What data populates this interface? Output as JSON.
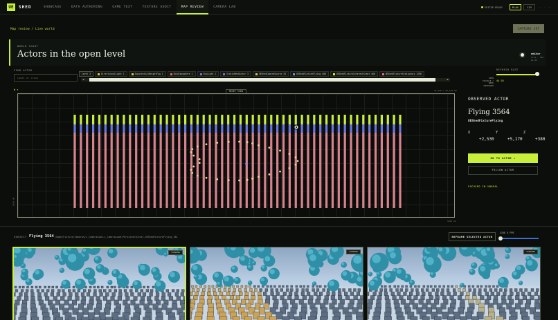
{
  "app": {
    "logo": "UE",
    "brand": "SHED"
  },
  "nav": [
    "SHOWCASE",
    "DATA AUTHORING",
    "GAME TEXT",
    "TEXTURE AUDIT",
    "MAP REVIEW",
    "CAMERA LAB"
  ],
  "nav_active": 4,
  "status": {
    "text": "EDITOR READY",
    "play": "PLAY",
    "sim": "SIM",
    "more": "· · ·"
  },
  "breadcrumb": "Map review / Live world",
  "capture_label": "CAPTURE SET",
  "header": {
    "eyebrow": "WORLD SCOUT",
    "title": "Actors in the open level",
    "editor_label": "editor",
    "editor_sub": "live · 120 ms 66"
  },
  "find": {
    "label": "FIND ACTOR",
    "placeholder": "Label or class"
  },
  "chips": [
    {
      "label": "Level 3",
      "color": ""
    },
    {
      "label": "DirectionalLight 1",
      "color": "#e2c04a"
    },
    {
      "label": "ExponentialHeightFog 1",
      "color": "#e2c04a"
    },
    {
      "label": "SkyAtmosphere 1",
      "color": "#e06a6a"
    },
    {
      "label": "SkyLight 1",
      "color": "#7d6ee0"
    },
    {
      "label": "StaticMeshActor 3",
      "color": "#7d6ee0"
    },
    {
      "label": "UEShedCameraSource 33",
      "color": "#e2c04a"
    },
    {
      "label": "UEShedFixtureFlying 400",
      "color": "#6a8ee6"
    },
    {
      "label": "UEShedFixtureInterestGrant 400",
      "color": "#c8f03a"
    },
    {
      "label": "UEShedFixtureStationary 1296",
      "color": "#e06a8a"
    }
  ],
  "refresh": {
    "label": "REFRESH RATE",
    "visible_label": "SEEN VISIBLE / NEED OBSERVED",
    "visible_value": "44 03",
    "level": 0.95
  },
  "map": {
    "corner": "Φ ▾",
    "reset_label": "RESET VIEW",
    "coords": "15,120 × 29,120 UU",
    "scale_y": "2000 UU",
    "scale_x": "5000 UU",
    "colors": {
      "stationary": "#d9828e",
      "flying": "#6a78e6",
      "interest": "#c8f03a",
      "camera": "#e8d49a",
      "selected": "#8f86ff"
    }
  },
  "observed": {
    "label": "OBSERVED ACTOR",
    "name": "Flying 3564",
    "class": "UEShedFixtureFlying",
    "x_label": "X",
    "y_label": "Y",
    "z_label": "Z",
    "x": "+2,530",
    "y": "+5,170",
    "z": "+380",
    "goto_label": "GO TO ACTOR ↗",
    "follow_label": "FOLLOW ACTOR",
    "focused_label": "FOCUSED IN UNREAL"
  },
  "subject": {
    "label": "SUBJECT",
    "name": "Flying 3564",
    "path": "/Game/Fixture/Cameras/L_CameraLoad.L_CameraLoad:PersistentLevel.UEShedFixtureFlying_181",
    "reframe_label": "REFRAME SELECTED ACTOR",
    "live_label": "LIVE 5 FPS",
    "live_level": 0.02
  },
  "cameras": [
    {
      "tag": "VIEWING",
      "selected": true
    },
    {
      "tag": "VIEWING",
      "selected": false
    },
    {
      "tag": "VIEWING",
      "selected": false
    }
  ]
}
